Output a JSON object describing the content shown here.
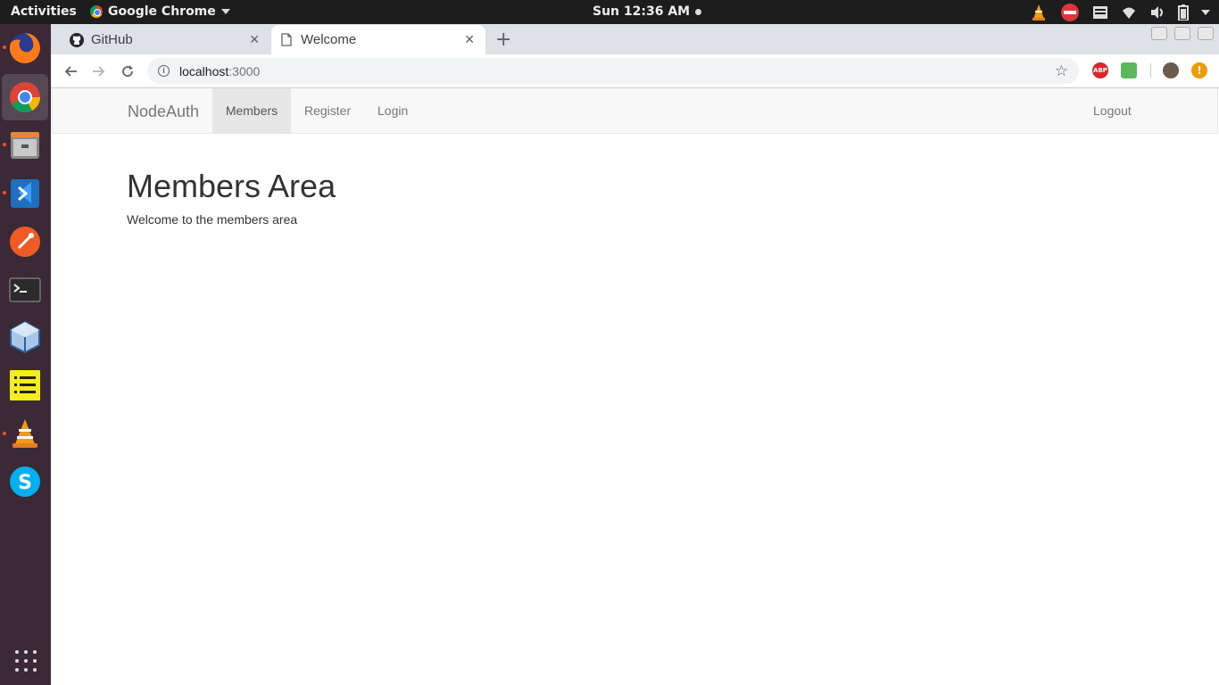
{
  "topbar": {
    "activities": "Activities",
    "app_name": "Google Chrome",
    "clock": "Sun 12:36 AM"
  },
  "dock": {
    "apps": [
      "firefox",
      "chrome",
      "files",
      "vscode",
      "postman",
      "terminal",
      "virtualbox",
      "notes",
      "vlc",
      "skype"
    ]
  },
  "browser": {
    "tabs": [
      {
        "title": "GitHub",
        "icon": "github-icon",
        "active": false
      },
      {
        "title": "Welcome",
        "icon": "page-icon",
        "active": true
      }
    ],
    "url_host": "localhost",
    "url_port": ":3000",
    "extensions": [
      {
        "name": "adblock-plus",
        "label": "ABP"
      }
    ]
  },
  "site": {
    "brand": "NodeAuth",
    "nav": [
      "Members",
      "Register",
      "Login"
    ],
    "nav_right": "Logout",
    "heading": "Members Area",
    "text": "Welcome to the members area"
  },
  "colors": {
    "accent_ubuntu": "#e95420",
    "navbar_bg": "#f8f8f8",
    "nav_active_bg": "#e7e7e7"
  }
}
